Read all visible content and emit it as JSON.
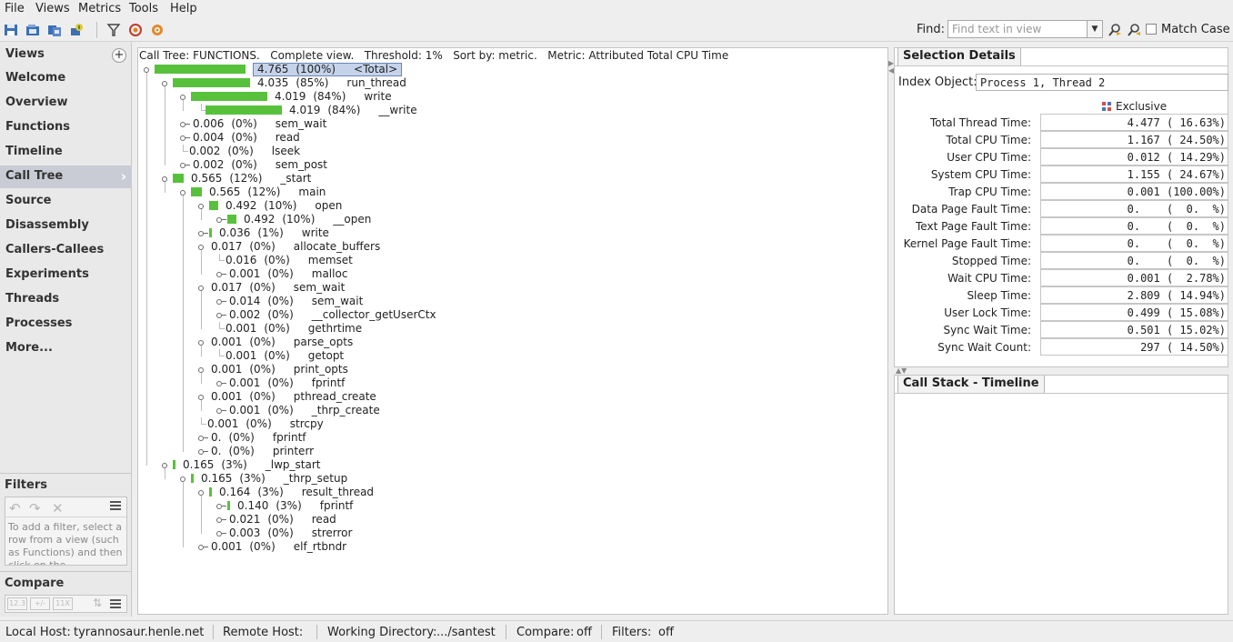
{
  "menu": [
    "File",
    "Views",
    "Metrics",
    "Tools",
    "Help"
  ],
  "toolbar": {
    "find_label": "Find:",
    "find_placeholder": "Find text in view",
    "match_case": "Match Case"
  },
  "views": {
    "title": "Views",
    "items": [
      "Welcome",
      "Overview",
      "Functions",
      "Timeline",
      "Call Tree",
      "Source",
      "Disassembly",
      "Callers-Callees",
      "Experiments",
      "Threads",
      "Processes",
      "More..."
    ],
    "active": "Call Tree"
  },
  "filters": {
    "title": "Filters",
    "hint": "To add a filter, select a row from a view (such as Functions) and then click on the"
  },
  "compare": {
    "title": "Compare",
    "buttons": [
      "12.3",
      "+/-",
      "11X"
    ]
  },
  "call_tree": {
    "header": "Call Tree: FUNCTIONS.   Complete view.   Threshold: 1%   Sort by: metric.   Metric: Attributed Total CPU Time",
    "rows": [
      {
        "depth": 0,
        "value": "4.765",
        "pct": "(100%)",
        "name": "<Total>",
        "bar": 100,
        "toggle": "expanded",
        "selected": true
      },
      {
        "depth": 1,
        "value": "4.035",
        "pct": "(85%)",
        "name": "run_thread",
        "bar": 85,
        "toggle": "expanded"
      },
      {
        "depth": 2,
        "value": "4.019",
        "pct": "(84%)",
        "name": "write",
        "bar": 84,
        "toggle": "expanded"
      },
      {
        "depth": 3,
        "value": "4.019",
        "pct": "(84%)",
        "name": "__write",
        "bar": 84,
        "toggle": "leaf"
      },
      {
        "depth": 2,
        "value": "0.006",
        "pct": "(0%)",
        "name": "sem_wait",
        "bar": 0,
        "toggle": "collapsed"
      },
      {
        "depth": 2,
        "value": "0.004",
        "pct": "(0%)",
        "name": "read",
        "bar": 0,
        "toggle": "collapsed"
      },
      {
        "depth": 2,
        "value": "0.002",
        "pct": "(0%)",
        "name": "lseek",
        "bar": 0,
        "toggle": "leaf"
      },
      {
        "depth": 2,
        "value": "0.002",
        "pct": "(0%)",
        "name": "sem_post",
        "bar": 0,
        "toggle": "collapsed"
      },
      {
        "depth": 1,
        "value": "0.565",
        "pct": "(12%)",
        "name": "_start",
        "bar": 12,
        "toggle": "expanded"
      },
      {
        "depth": 2,
        "value": "0.565",
        "pct": "(12%)",
        "name": "main",
        "bar": 12,
        "toggle": "expanded"
      },
      {
        "depth": 3,
        "value": "0.492",
        "pct": "(10%)",
        "name": "open",
        "bar": 10,
        "toggle": "expanded"
      },
      {
        "depth": 4,
        "value": "0.492",
        "pct": "(10%)",
        "name": "__open",
        "bar": 10,
        "toggle": "collapsed"
      },
      {
        "depth": 3,
        "value": "0.036",
        "pct": "(1%)",
        "name": "write",
        "bar": 1,
        "toggle": "collapsed"
      },
      {
        "depth": 3,
        "value": "0.017",
        "pct": "(0%)",
        "name": "allocate_buffers",
        "bar": 0,
        "toggle": "expanded"
      },
      {
        "depth": 4,
        "value": "0.016",
        "pct": "(0%)",
        "name": "memset",
        "bar": 0,
        "toggle": "leaf"
      },
      {
        "depth": 4,
        "value": "0.001",
        "pct": "(0%)",
        "name": "malloc",
        "bar": 0,
        "toggle": "collapsed"
      },
      {
        "depth": 3,
        "value": "0.017",
        "pct": "(0%)",
        "name": "sem_wait",
        "bar": 0,
        "toggle": "expanded"
      },
      {
        "depth": 4,
        "value": "0.014",
        "pct": "(0%)",
        "name": "sem_wait",
        "bar": 0,
        "toggle": "collapsed"
      },
      {
        "depth": 4,
        "value": "0.002",
        "pct": "(0%)",
        "name": "__collector_getUserCtx",
        "bar": 0,
        "toggle": "collapsed"
      },
      {
        "depth": 4,
        "value": "0.001",
        "pct": "(0%)",
        "name": "gethrtime",
        "bar": 0,
        "toggle": "leaf"
      },
      {
        "depth": 3,
        "value": "0.001",
        "pct": "(0%)",
        "name": "parse_opts",
        "bar": 0,
        "toggle": "expanded"
      },
      {
        "depth": 4,
        "value": "0.001",
        "pct": "(0%)",
        "name": "getopt",
        "bar": 0,
        "toggle": "leaf"
      },
      {
        "depth": 3,
        "value": "0.001",
        "pct": "(0%)",
        "name": "print_opts",
        "bar": 0,
        "toggle": "expanded"
      },
      {
        "depth": 4,
        "value": "0.001",
        "pct": "(0%)",
        "name": "fprintf",
        "bar": 0,
        "toggle": "collapsed"
      },
      {
        "depth": 3,
        "value": "0.001",
        "pct": "(0%)",
        "name": "pthread_create",
        "bar": 0,
        "toggle": "expanded"
      },
      {
        "depth": 4,
        "value": "0.001",
        "pct": "(0%)",
        "name": "_thrp_create",
        "bar": 0,
        "toggle": "collapsed"
      },
      {
        "depth": 3,
        "value": "0.001",
        "pct": "(0%)",
        "name": "strcpy",
        "bar": 0,
        "toggle": "leaf"
      },
      {
        "depth": 3,
        "value": "0.",
        "pct": "(0%)",
        "name": "fprintf",
        "bar": 0,
        "toggle": "collapsed"
      },
      {
        "depth": 3,
        "value": "0.",
        "pct": "(0%)",
        "name": "printerr",
        "bar": 0,
        "toggle": "collapsed"
      },
      {
        "depth": 1,
        "value": "0.165",
        "pct": "(3%)",
        "name": "_lwp_start",
        "bar": 3,
        "toggle": "expanded"
      },
      {
        "depth": 2,
        "value": "0.165",
        "pct": "(3%)",
        "name": "_thrp_setup",
        "bar": 3,
        "toggle": "expanded"
      },
      {
        "depth": 3,
        "value": "0.164",
        "pct": "(3%)",
        "name": "result_thread",
        "bar": 3,
        "toggle": "expanded"
      },
      {
        "depth": 4,
        "value": "0.140",
        "pct": "(3%)",
        "name": "fprintf",
        "bar": 3,
        "toggle": "collapsed"
      },
      {
        "depth": 4,
        "value": "0.021",
        "pct": "(0%)",
        "name": "read",
        "bar": 0,
        "toggle": "collapsed"
      },
      {
        "depth": 4,
        "value": "0.003",
        "pct": "(0%)",
        "name": "strerror",
        "bar": 0,
        "toggle": "collapsed"
      },
      {
        "depth": 3,
        "value": "0.001",
        "pct": "(0%)",
        "name": "elf_rtbndr",
        "bar": 0,
        "toggle": "collapsed"
      }
    ]
  },
  "selection_details": {
    "tab": "Selection Details",
    "index_label": "Index Object:",
    "index_value": "Process 1, Thread 2",
    "column": "Exclusive",
    "metrics": [
      {
        "label": "Total Thread Time:",
        "value": "4.477 ( 16.63%)"
      },
      {
        "label": "Total CPU Time:",
        "value": "1.167 ( 24.50%)"
      },
      {
        "label": "User CPU Time:",
        "value": "0.012 ( 14.29%)"
      },
      {
        "label": "System CPU Time:",
        "value": "1.155 ( 24.67%)"
      },
      {
        "label": "Trap CPU Time:",
        "value": "0.001 (100.00%)"
      },
      {
        "label": "Data Page Fault Time:",
        "value": "0.    (  0.  %)"
      },
      {
        "label": "Text Page Fault Time:",
        "value": "0.    (  0.  %)"
      },
      {
        "label": "Kernel Page Fault Time:",
        "value": "0.    (  0.  %)"
      },
      {
        "label": "Stopped Time:",
        "value": "0.    (  0.  %)"
      },
      {
        "label": "Wait CPU Time:",
        "value": "0.001 (  2.78%)"
      },
      {
        "label": "Sleep Time:",
        "value": "2.809 ( 14.94%)"
      },
      {
        "label": "User Lock Time:",
        "value": "0.499 ( 15.08%)"
      },
      {
        "label": "Sync Wait Time:",
        "value": "0.501 ( 15.02%)"
      },
      {
        "label": "Sync Wait Count:",
        "value": "297 ( 14.50%)"
      }
    ]
  },
  "call_stack": {
    "tab": "Call Stack - Timeline"
  },
  "status": {
    "local_host_label": "Local Host:",
    "local_host": "tyrannosaur.henle.net",
    "remote_host_label": "Remote Host:",
    "working_dir_label": "Working Directory:",
    "working_dir": ".../santest",
    "compare_label": "Compare:",
    "compare": "off",
    "filters_label": "Filters:",
    "filters": "off"
  },
  "colors": {
    "bar": "#58c13c",
    "selected_bg": "#c5d3ea",
    "active_view": "#c9ccd4"
  }
}
